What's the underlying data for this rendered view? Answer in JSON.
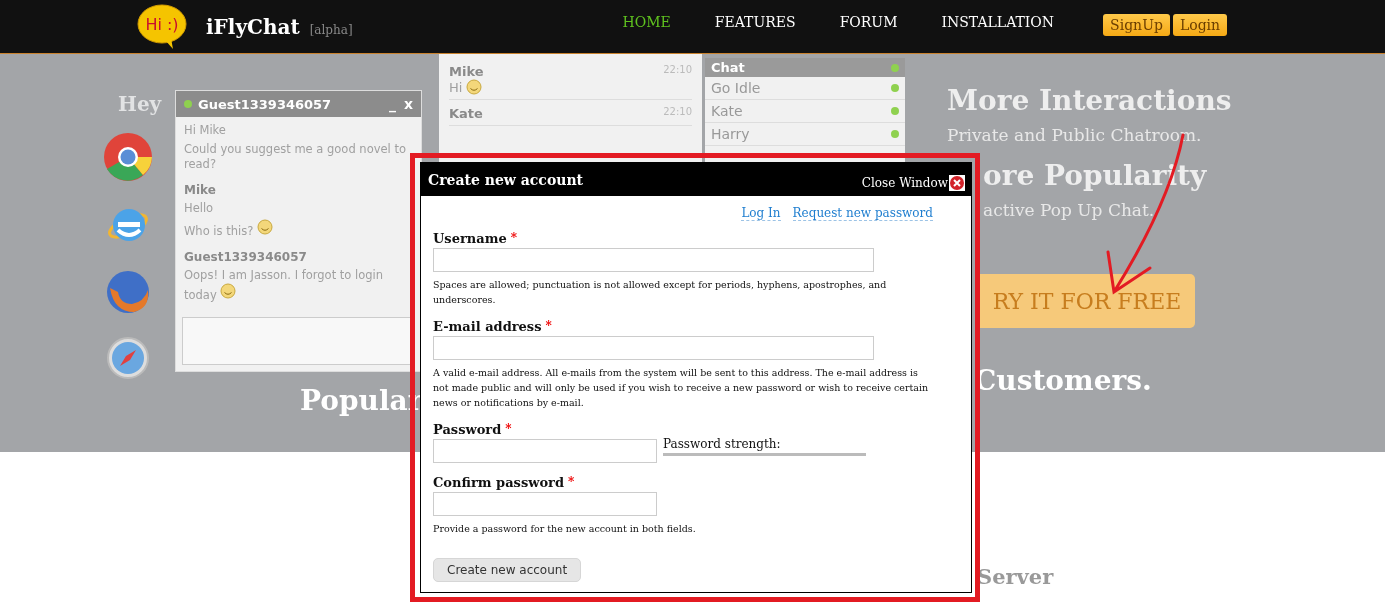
{
  "nav": {
    "logo_badge": "Hi :)",
    "brand": "iFlyChat",
    "tag": "[alpha]",
    "links": [
      {
        "label": "HOME",
        "selected": true
      },
      {
        "label": "FEATURES",
        "selected": false
      },
      {
        "label": "FORUM",
        "selected": false
      },
      {
        "label": "INSTALLATION",
        "selected": false
      }
    ],
    "buttons": [
      "SignUp",
      "Login"
    ]
  },
  "hero": {
    "faded_text": "Hey",
    "chat_window": {
      "title": "Guest1339346057",
      "controls": [
        "_",
        "x"
      ],
      "lines": [
        {
          "kind": "text",
          "text": "Hi Mike",
          "emoji": false
        },
        {
          "kind": "text",
          "text": "Could you suggest me a good novel to read?",
          "emoji": false
        },
        {
          "kind": "sender",
          "text": "Mike",
          "emoji": false
        },
        {
          "kind": "text",
          "text": "Hello",
          "emoji": false
        },
        {
          "kind": "text",
          "text": "Who is this?",
          "emoji": true
        },
        {
          "kind": "sender",
          "text": "Guest1339346057",
          "emoji": false
        },
        {
          "kind": "text",
          "text": "Oops! I am Jasson. I forgot to login today",
          "emoji": true
        }
      ]
    },
    "conversation": [
      {
        "sender": "Mike",
        "time": "22:10",
        "text": "Hi",
        "emoji": true
      },
      {
        "sender": "Kate",
        "time": "22:10",
        "emoji": false
      }
    ],
    "contacts": {
      "title": "Chat",
      "status": "Go Idle",
      "people": [
        "Kate",
        "Harry"
      ]
    },
    "overlay_heading": "Popular",
    "features": [
      {
        "heading": "More Interactions",
        "text": "Private and Public Chatroom."
      }
    ],
    "partly_covered_features": [
      {
        "heading": "ore Popularity",
        "text": "active Pop Up Chat."
      }
    ],
    "cta": "RY IT FOR FREE",
    "tagline": "Customers."
  },
  "below": {
    "heading": "Server"
  },
  "dialog": {
    "title": "Create new account",
    "close": "Close Window",
    "links": [
      "Log In",
      "Request new password"
    ],
    "fields": [
      {
        "label": "Username",
        "marker": "*",
        "kind": "wide",
        "description": "Spaces are allowed; punctuation is not allowed except for periods, hyphens, apostrophes, and underscores."
      },
      {
        "label": "E-mail address",
        "marker": "*",
        "kind": "wide",
        "description": "A valid e-mail address. All e-mails from the system will be sent to this address. The e-mail address is not made public and will only be used if you wish to receive a new password or wish to receive certain news or notifications by e-mail."
      },
      {
        "label": "Password",
        "marker": "*",
        "kind": "password",
        "strength": "Password strength:"
      },
      {
        "label": "Confirm password",
        "marker": "*",
        "kind": "narrow",
        "description": "Provide a password for the new account in both fields."
      }
    ],
    "button": "Create new account"
  }
}
